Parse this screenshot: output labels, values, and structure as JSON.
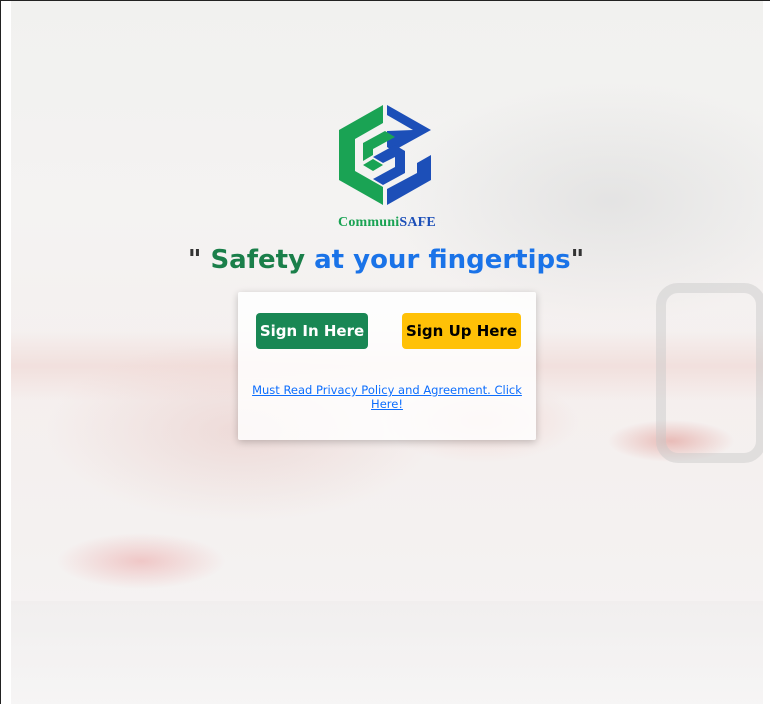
{
  "brand": {
    "name_part1": "Communi",
    "name_part2": "SAFE",
    "logo_icon": "communisafe-hexagon-logo",
    "colors": {
      "green": "#1aa354",
      "blue": "#1c4fb8"
    }
  },
  "tagline": {
    "open_quote": "\" ",
    "word1": "Safety",
    "rest": " at your fingertips",
    "close_quote": "\""
  },
  "actions": {
    "signin_label": "Sign In Here",
    "signup_label": "Sign Up Here",
    "policy_link": "Must Read Privacy Policy and Agreement. Click Here!"
  },
  "colors": {
    "signin_bg": "#198754",
    "signup_bg": "#ffc107",
    "link": "#0d6efd",
    "tagline_green": "#1a7f4a",
    "tagline_blue": "#1a73e8"
  }
}
